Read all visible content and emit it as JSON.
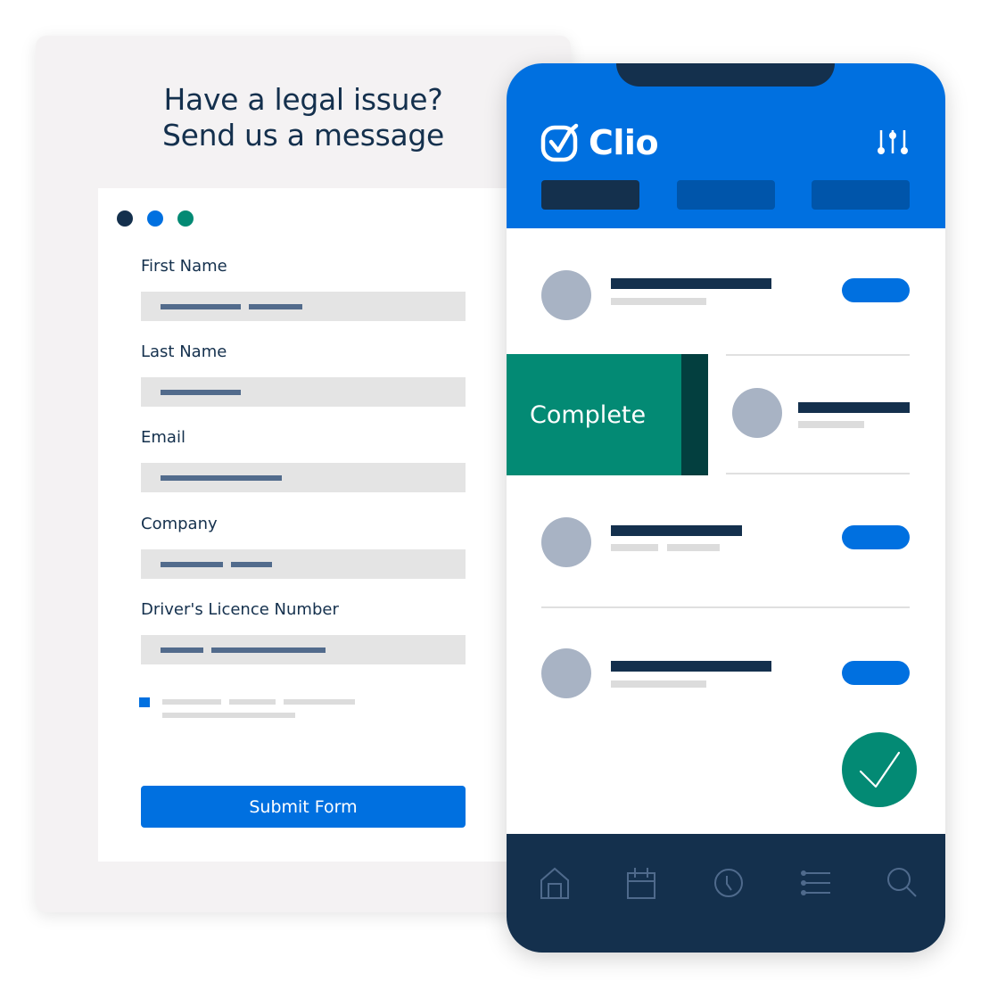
{
  "form": {
    "title_line1": "Have a legal issue?",
    "title_line2": "Send us a message",
    "window_dots": [
      {
        "name": "dot-dark",
        "color": "#14304d"
      },
      {
        "name": "dot-blue",
        "color": "#0070e0"
      },
      {
        "name": "dot-green",
        "color": "#038a74"
      }
    ],
    "fields": [
      {
        "label": "First Name",
        "value": "(redacted placeholder text)"
      },
      {
        "label": "Last Name",
        "value": "(redacted placeholder text)"
      },
      {
        "label": "Email",
        "value": "(redacted placeholder text)"
      },
      {
        "label": "Company",
        "value": "(redacted placeholder text)"
      },
      {
        "label": "Driver's Licence Number",
        "value": "(redacted placeholder text)"
      }
    ],
    "consent_checked": true,
    "submit_label": "Submit Form"
  },
  "phone": {
    "brand": "Clio",
    "header_tabs": [
      {
        "name": "tab-1",
        "active": true
      },
      {
        "name": "tab-2",
        "active": false
      },
      {
        "name": "tab-3",
        "active": false
      }
    ],
    "swipe_action_label": "Complete",
    "fab_icon": "checkmark-icon",
    "bottom_nav": [
      {
        "name": "home",
        "icon": "home-icon"
      },
      {
        "name": "calendar",
        "icon": "calendar-icon"
      },
      {
        "name": "time",
        "icon": "clock-icon"
      },
      {
        "name": "tasks",
        "icon": "list-icon"
      },
      {
        "name": "search",
        "icon": "search-icon"
      }
    ]
  },
  "colors": {
    "brand_blue": "#0070e0",
    "navy": "#14304d",
    "green": "#038a74",
    "dark_green": "#033f3f",
    "avatar_gray": "#a8b3c4",
    "input_bg": "#e4e4e4"
  }
}
